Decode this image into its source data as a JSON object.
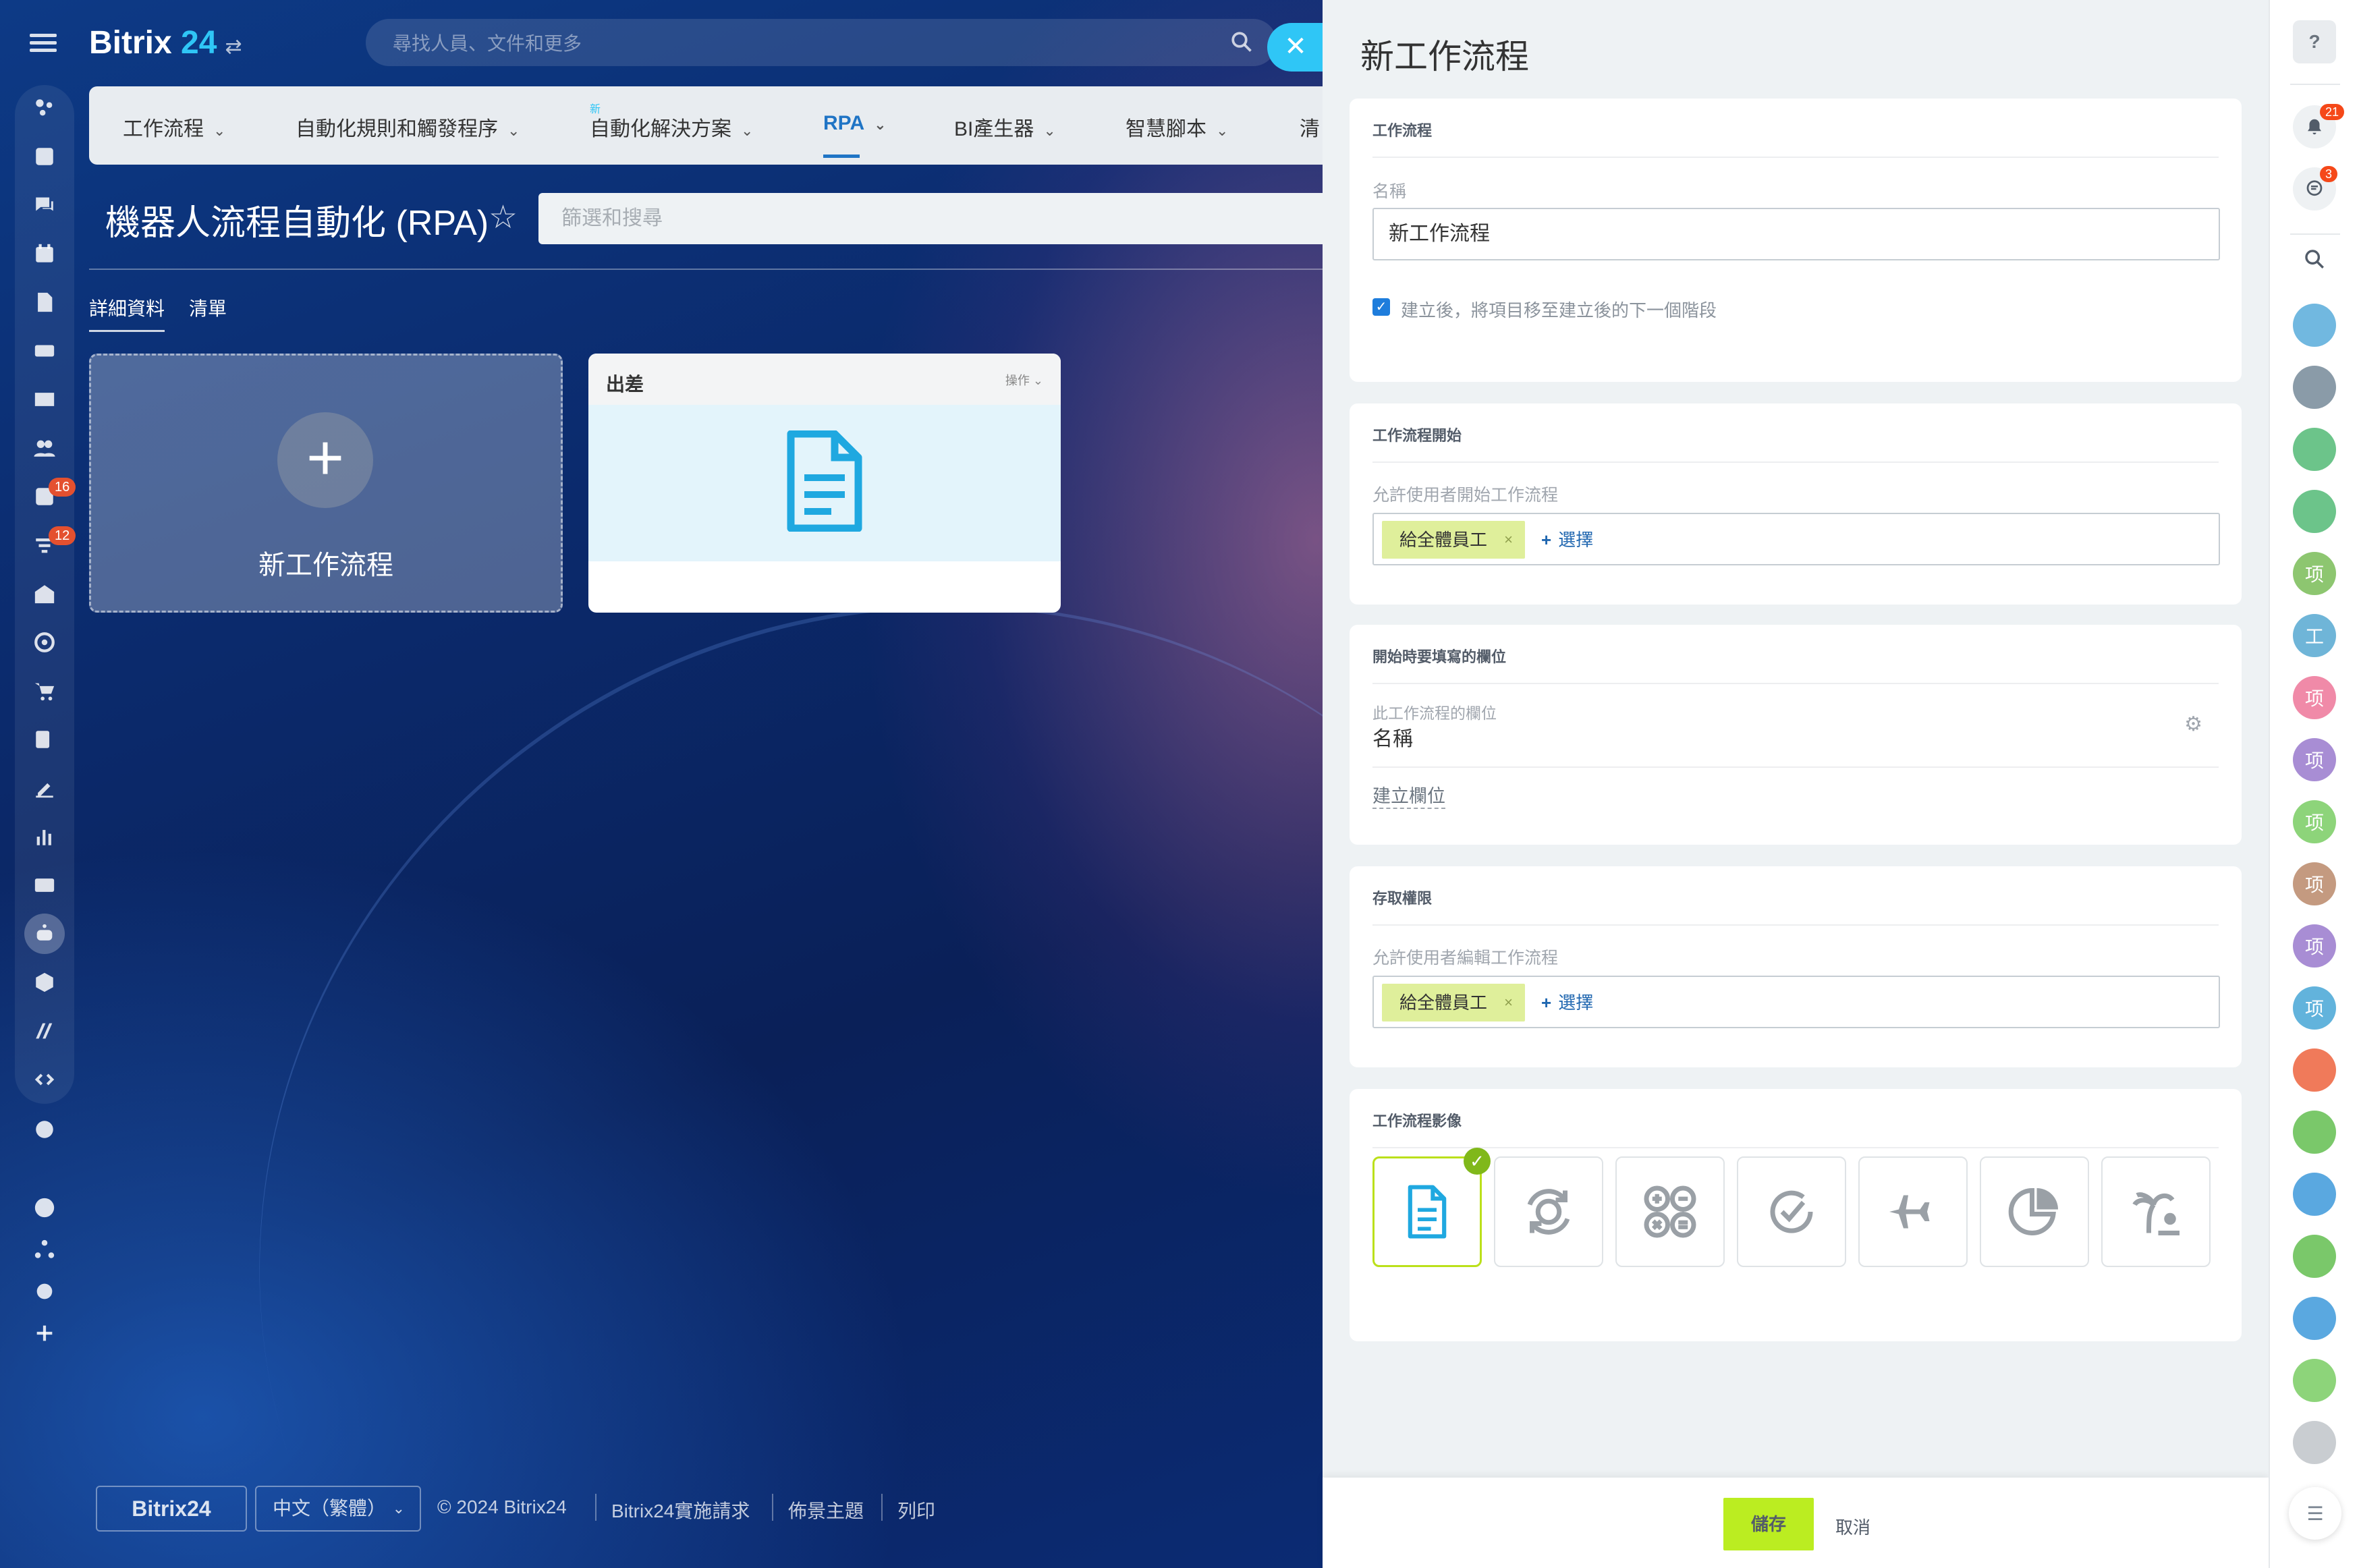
{
  "app": {
    "logo_name": "Bitrix",
    "logo_num": "24"
  },
  "search": {
    "placeholder": "尋找人員、文件和更多"
  },
  "left_rail": {
    "badges": [
      "16",
      "12"
    ]
  },
  "nav": {
    "tabs": [
      {
        "label": "工作流程",
        "active": false
      },
      {
        "label": "自動化規則和觸發程序",
        "active": false
      },
      {
        "label": "自動化解決方案",
        "active": false,
        "new_badge": "新"
      },
      {
        "label": "RPA",
        "active": true
      },
      {
        "label": "BI產生器",
        "active": false
      },
      {
        "label": "智慧腳本",
        "active": false
      },
      {
        "label": "清",
        "active": false
      }
    ]
  },
  "page": {
    "title": "機器人流程自動化 (RPA)",
    "filter_placeholder": "篩選和搜尋",
    "sub_tabs": [
      "詳細資料",
      "清單"
    ],
    "new_card_label": "新工作流程",
    "trip_card": {
      "title": "出差",
      "ops": "操作"
    }
  },
  "footer": {
    "logo": "Bitrix24",
    "language": "中文（繁體）",
    "links": [
      "© 2024 Bitrix24",
      "Bitrix24實施請求",
      "佈景主題",
      "列印"
    ]
  },
  "slider": {
    "title": "新工作流程",
    "sections": {
      "workflow": {
        "title": "工作流程",
        "name_label": "名稱",
        "name_value": "新工作流程",
        "checkbox_checked": true,
        "checkbox_label": "建立後，將項目移至建立後的下一個階段"
      },
      "start": {
        "title": "工作流程開始",
        "allow_label": "允許使用者開始工作流程",
        "tag": "給全體員工",
        "select": "選擇"
      },
      "fields": {
        "title": "開始時要填寫的欄位",
        "field_label": "此工作流程的欄位",
        "field_value": "名稱",
        "create_link": "建立欄位"
      },
      "access": {
        "title": "存取權限",
        "allow_label": "允許使用者編輯工作流程",
        "tag": "給全體員工",
        "select": "選擇"
      },
      "image": {
        "title": "工作流程影像",
        "tiles": [
          "document-icon",
          "gear-sync-icon",
          "calculator-icon",
          "check-refresh-icon",
          "airplane-icon",
          "pie-chart-icon",
          "palm-tree-icon"
        ],
        "selected_index": 0
      }
    },
    "save_label": "儲存",
    "cancel_label": "取消"
  },
  "right_rail": {
    "notifications_badge": "21",
    "chat_badge": "3",
    "avatars": [
      {
        "label": "",
        "color": "#71b8e0"
      },
      {
        "label": "",
        "color": "#8a9ba8"
      },
      {
        "label": "",
        "color": "#6cc48a"
      },
      {
        "label": "",
        "color": "#6cc48a"
      },
      {
        "label": "项",
        "color": "#8dc670"
      },
      {
        "label": "工",
        "color": "#6fb5d8"
      },
      {
        "label": "项",
        "color": "#f08aa8"
      },
      {
        "label": "项",
        "color": "#a88dd4"
      },
      {
        "label": "项",
        "color": "#8dd47a"
      },
      {
        "label": "项",
        "color": "#c49a80"
      },
      {
        "label": "项",
        "color": "#a88dd4"
      },
      {
        "label": "项",
        "color": "#62b3dc"
      },
      {
        "label": "",
        "color": "#f07a5a"
      },
      {
        "label": "",
        "color": "#7ac86a"
      },
      {
        "label": "",
        "color": "#5aa8e0"
      },
      {
        "label": "",
        "color": "#7ac86a"
      },
      {
        "label": "",
        "color": "#5aa8e0"
      },
      {
        "label": "",
        "color": "#8dd47a"
      },
      {
        "label": "",
        "color": "#c9cdd1"
      }
    ]
  }
}
